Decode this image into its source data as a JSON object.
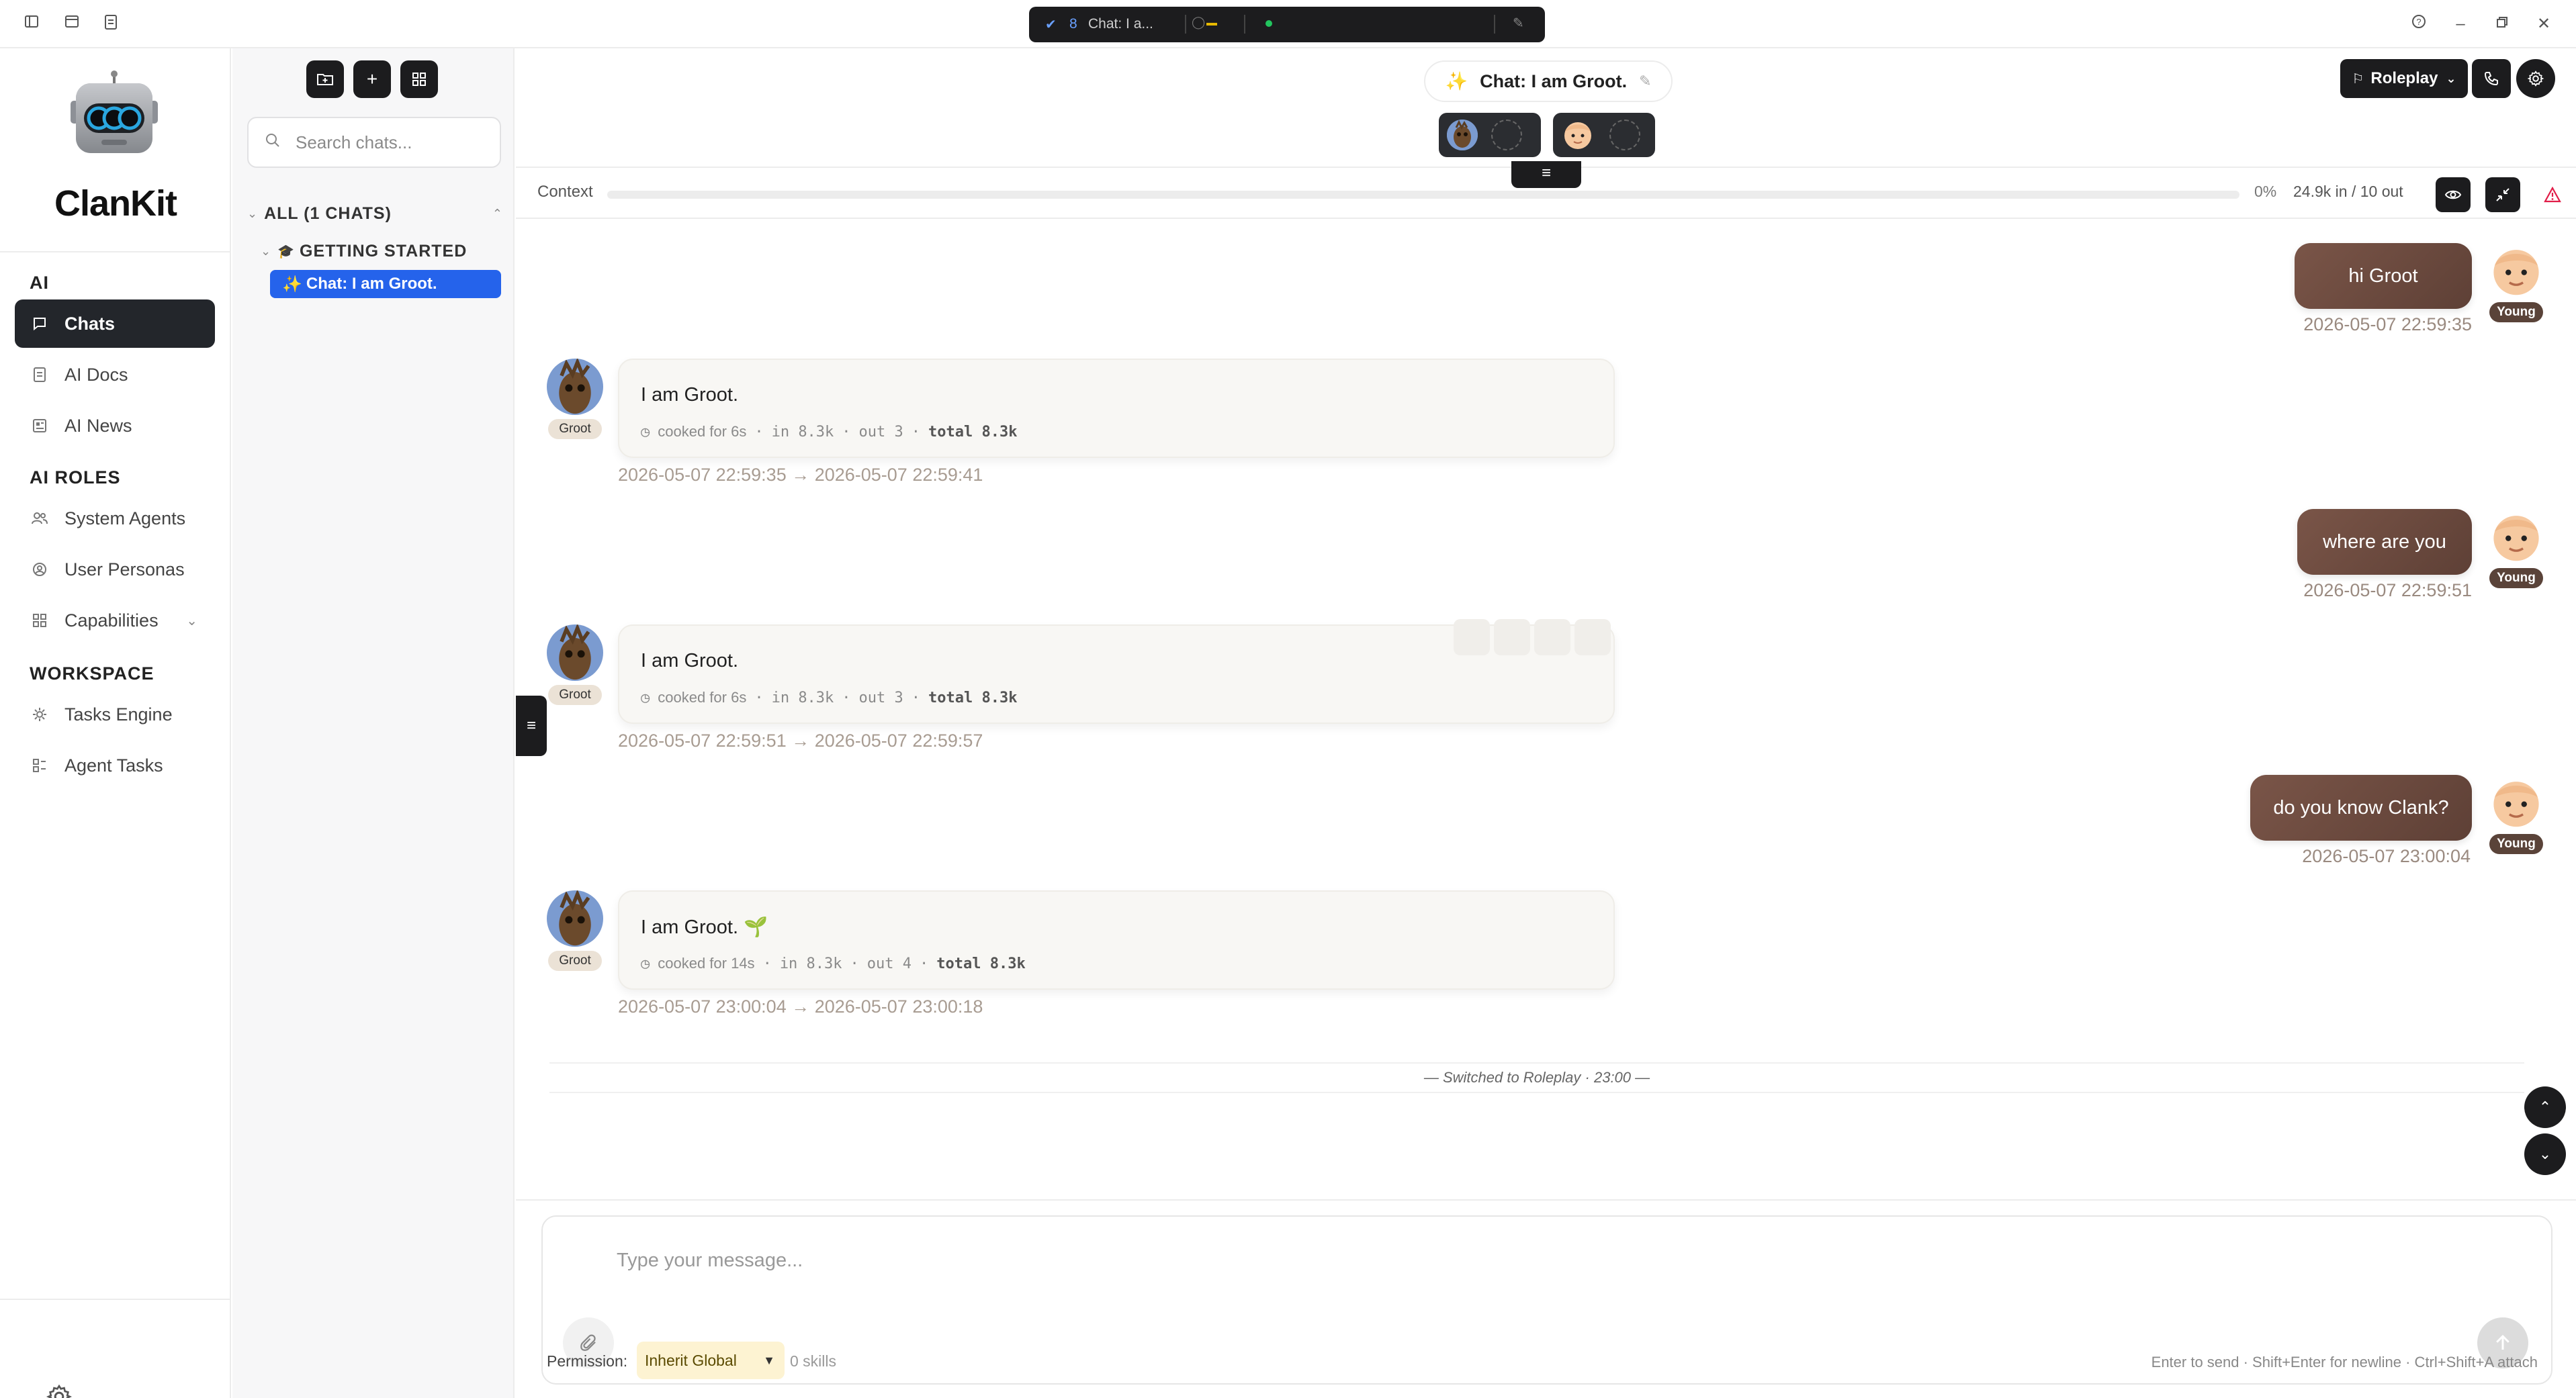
{
  "window": {
    "tab_label": "Chat: I a...",
    "tab_count": "8"
  },
  "sidebar": {
    "brand": "ClanKit",
    "sections": [
      {
        "label": "AI"
      },
      {
        "label": "AI ROLES"
      },
      {
        "label": "WORKSPACE"
      }
    ],
    "items": [
      {
        "label": "Chats",
        "icon": "chat-bubble-icon",
        "active": true
      },
      {
        "label": "AI Docs",
        "icon": "document-icon"
      },
      {
        "label": "AI News",
        "icon": "newspaper-icon"
      },
      {
        "label": "System Agents",
        "icon": "users-icon"
      },
      {
        "label": "User Personas",
        "icon": "user-circle-icon"
      },
      {
        "label": "Capabilities",
        "icon": "grid-icon"
      },
      {
        "label": "Tasks Engine",
        "icon": "cog-engine-icon"
      },
      {
        "label": "Agent Tasks",
        "icon": "task-grid-icon"
      }
    ]
  },
  "chatlist": {
    "search_placeholder": "Search chats...",
    "group_all": "ALL (1 CHATS)",
    "group_started": "GETTING STARTED",
    "active_chat": "Chat: I am Groot."
  },
  "header": {
    "chat_title": "Chat: I am Groot.",
    "mode_button": "Roleplay"
  },
  "context": {
    "label": "Context",
    "percent": "0%",
    "progress_fraction": 0.0,
    "tokens": "24.9k in / 10 out"
  },
  "messages": [
    {
      "role": "user",
      "text": "hi Groot",
      "timestamp": "2026-05-07 22:59:35",
      "persona": "Young"
    },
    {
      "role": "assistant",
      "text": "I am Groot.",
      "meta_cooked": "cooked for 6s",
      "meta_in": "in 8.3k",
      "meta_out": "out 3",
      "meta_total": "total 8.3k",
      "timestamp": "2026-05-07 22:59:35 → 2026-05-07 22:59:41",
      "persona": "Groot"
    },
    {
      "role": "user",
      "text": "where are you",
      "timestamp": "2026-05-07 22:59:51",
      "persona": "Young"
    },
    {
      "role": "assistant",
      "text": "I am Groot.",
      "meta_cooked": "cooked for 6s",
      "meta_in": "in 8.3k",
      "meta_out": "out 3",
      "meta_total": "total 8.3k",
      "timestamp": "2026-05-07 22:59:51 → 2026-05-07 22:59:57",
      "persona": "Groot"
    },
    {
      "role": "user",
      "text": "do you know Clank?",
      "timestamp": "2026-05-07 23:00:04",
      "persona": "Young"
    },
    {
      "role": "assistant",
      "text": "I am Groot. 🌱",
      "meta_cooked": "cooked for 14s",
      "meta_in": "in 8.3k",
      "meta_out": "out 4",
      "meta_total": "total 8.3k",
      "timestamp": "2026-05-07 23:00:04 → 2026-05-07 23:00:18",
      "persona": "Groot"
    }
  ],
  "system_note": "— Switched to Roleplay · 23:00 —",
  "composer": {
    "placeholder": "Type your message...",
    "permission_label": "Permission:",
    "permission_value": "Inherit Global",
    "skills": "0 skills",
    "hint": "Enter to send · Shift+Enter for newline · Ctrl+Shift+A attach"
  },
  "colors": {
    "accent": "#2563eb",
    "dark": "#1c1c1e",
    "user_bubble": "#6b4a3e",
    "permission_bg": "#fdf3d2"
  }
}
